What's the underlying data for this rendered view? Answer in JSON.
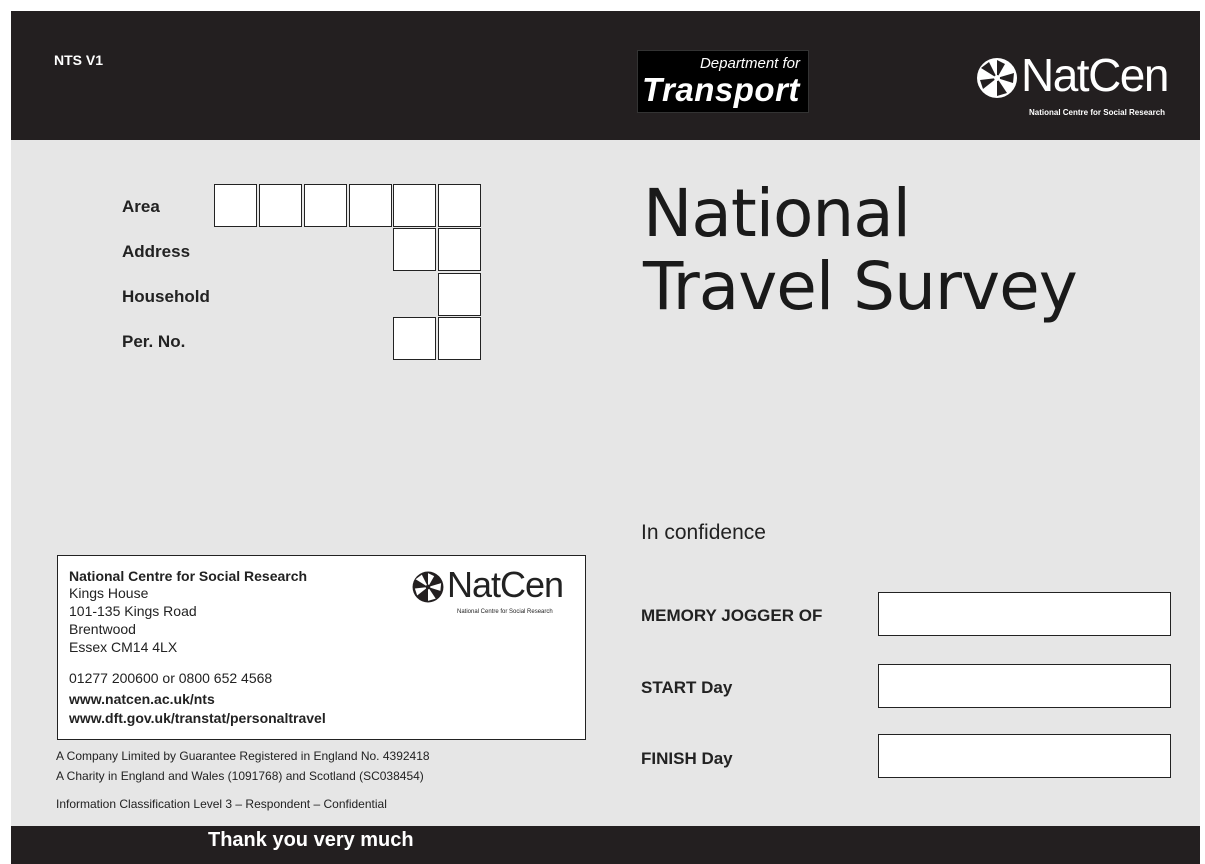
{
  "header": {
    "code": "NTS V1",
    "dft_logo": {
      "line1": "Department for",
      "line2": "Transport"
    },
    "natcen_logo": {
      "word": "NatCen",
      "subtitle": "National Centre for Social Research"
    }
  },
  "reference": {
    "area_label": "Area",
    "address_label": "Address",
    "household_label": "Household",
    "person_label": "Per. No."
  },
  "title": {
    "line1": "National",
    "line2": "Travel Survey"
  },
  "contact": {
    "lines": [
      "National Centre for Social Research",
      "Kings House",
      "101-135 Kings Road",
      "Brentwood",
      "Essex  CM14 4LX",
      "01277 200600 or 0800 652 4568",
      "www.natcen.ac.uk/nts",
      "www.dft.gov.uk/transtat/personaltravel"
    ],
    "logo_word": "NatCen",
    "logo_subtitle": "National Centre for Social Research"
  },
  "legal": {
    "line1": "A Company Limited by Guarantee  Registered in England No. 4392418",
    "line2": "A Charity in England and Wales (1091768) and Scotland (SC038454)",
    "classification": "Information Classification Level 3 – Respondent – Confidential"
  },
  "form": {
    "confidence": "In confidence",
    "memory_label": "MEMORY JOGGER OF",
    "start_label": "START Day",
    "finish_label": "FINISH Day"
  },
  "footer": {
    "text": "Thank you very much"
  }
}
